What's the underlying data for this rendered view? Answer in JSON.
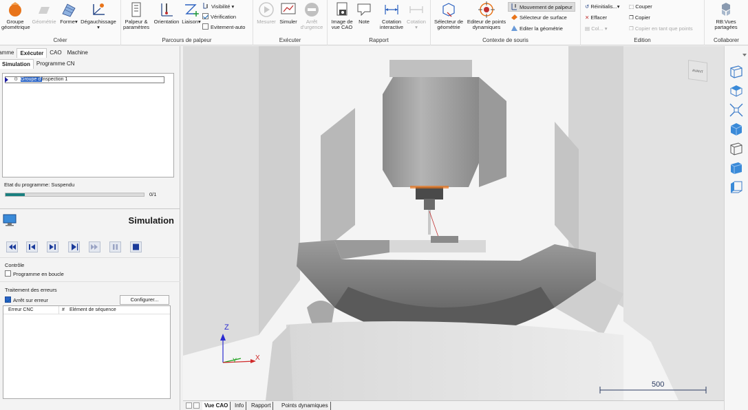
{
  "ribbon": {
    "groups": {
      "create": "Créer",
      "probe_path": "Parcours de palpeur",
      "execute": "Exécuter",
      "report": "Rapport",
      "mouse_context": "Contexte de souris",
      "edit": "Edition",
      "collaborate": "Collaborer"
    },
    "buttons": {
      "geom_group": "Groupe\ngéométrique",
      "geometry": "Géométrie",
      "form": "Forme",
      "alignment": "Dégauchissage",
      "probe_params": "Palpeur &\nparamètres",
      "orientation": "Orientation",
      "link": "Liaison",
      "visibility": "Visibilité",
      "verification": "Vérification",
      "auto_avoid": "Evitement-auto",
      "measure": "Mesurer",
      "simulate": "Simuler",
      "emergency_stop": "Arrêt\nd'urgence",
      "cad_image": "Image de\nvue CAO",
      "note": "Note",
      "interactive_dim": "Cotation\ninteractive",
      "dimension": "Cotation",
      "geom_selector": "Sélecteur de\ngéométrie",
      "dyn_points_editor": "Editeur de points\ndynamiques",
      "probe_move": "Mouvement de palpeur",
      "surface_selector": "Sélecteur de surface",
      "edit_geometry": "Editer la géométrie",
      "reset": "Réinitialis...",
      "erase": "Effacer",
      "paste": "Col...",
      "cut": "Couper",
      "copy": "Copier",
      "copy_as_points": "Copier en tant que points",
      "shared_views": "RB:Vues\npartagées"
    }
  },
  "left": {
    "top_tabs": [
      "Gamme",
      "Exécuter",
      "CAO",
      "Machine"
    ],
    "sub_tabs": [
      "Simulation",
      "Programme CN"
    ],
    "tree_item": "Groupe d'Inspection 1",
    "tree_item_hl": "Groupe d'",
    "tree_item_rest": "Inspection 1",
    "program_state": "Etat du programme: Suspendu",
    "progress_fraction": 0.14,
    "progress_count": "0/1",
    "sim_title": "Simulation",
    "control_label": "Contrôle",
    "loop_program": "Programme en boucle",
    "error_handling": "Traitement des erreurs",
    "stop_on_error": "Arrêt sur erreur",
    "configure": "Configurer...",
    "err_col1": "Erreur CNC",
    "err_col2": "#",
    "err_col3": "Elément de séquence"
  },
  "viewport": {
    "view_cube_label": "AVANT",
    "axis_z": "Z",
    "axis_y": "Y",
    "axis_x": "X",
    "scale_value": "500"
  },
  "bottom_tabs": [
    "Vue CAO",
    "Info",
    "Rapport",
    "Points dynamiques"
  ]
}
